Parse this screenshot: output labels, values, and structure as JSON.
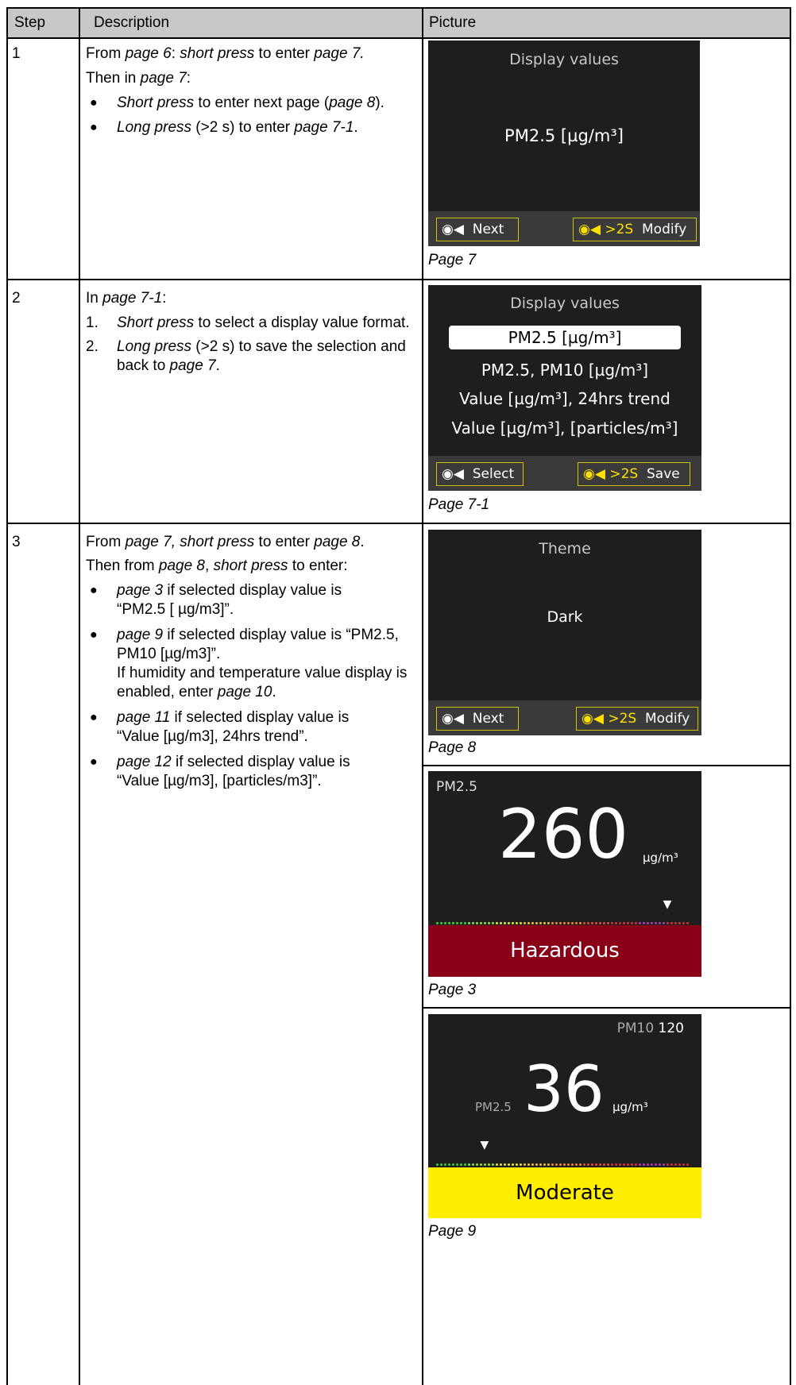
{
  "table": {
    "headers": {
      "step": "Step",
      "description": "Description",
      "picture": "Picture"
    },
    "row1": {
      "step": "1",
      "l1_a": "From ",
      "l1_b": "page 6",
      "l1_c": ": ",
      "l1_d": "short press",
      "l1_e": " to enter ",
      "l1_f": "page 7.",
      "l2_a": "Then in ",
      "l2_b": "page 7",
      "l2_c": ":",
      "b1_a": "Short press",
      "b1_b": " to enter next page (",
      "b1_c": "page 8",
      "b1_d": ").",
      "b2_a": "Long press",
      "b2_b": " (>2 s) to enter ",
      "b2_c": "page 7-1",
      "b2_d": ".",
      "caption": "Page 7"
    },
    "row2": {
      "step": "2",
      "l1_a": "In ",
      "l1_b": "page 7-1",
      "l1_c": ":",
      "n1": "1.",
      "n1_a": "Short press",
      "n1_b": " to select a display value format.",
      "n2": "2.",
      "n2_a": "Long press",
      "n2_b": " (>2 s) to save the selection and",
      "n2_c": "back to ",
      "n2_d": "page 7",
      "n2_e": ".",
      "caption": "Page 7-1"
    },
    "row3": {
      "step": "3",
      "l1_a": "From ",
      "l1_b": "page 7, short press",
      "l1_c": " to enter ",
      "l1_d": "page 8",
      "l1_e": ".",
      "l2_a": "Then from ",
      "l2_b": "page 8",
      "l2_c": ", ",
      "l2_d": "short press",
      "l2_e": " to enter:",
      "b1_a": "page 3",
      "b1_b": " if selected display value is",
      "b1_c": "“PM2.5 [ µg/m3]”.",
      "b2_a": "page 9",
      "b2_b": " if selected display value is “PM2.5,",
      "b2_c": "PM10 [µg/m3]”.",
      "b2_d": "If humidity and temperature value display is",
      "b2_e": "enabled, enter ",
      "b2_f": "page 10",
      "b2_g": ".",
      "b3_a": "page 11",
      "b3_b": " if selected display value is",
      "b3_c": "“Value [µg/m3], 24hrs trend”.",
      "b4_a": "page 12",
      "b4_b": " if selected display value is",
      "b4_c": "“Value [µg/m3], [particles/m3]”.",
      "caption8": "Page 8",
      "caption3": "Page 3",
      "caption9": "Page 9"
    }
  },
  "screens": {
    "p7": {
      "title": "Display values",
      "value": "PM2.5 [µg/m³]",
      "btn_left": "Next",
      "btn_right_long": ">2S",
      "btn_right": "Modify"
    },
    "p71": {
      "title": "Display values",
      "options": [
        "PM2.5 [µg/m³]",
        "PM2.5, PM10 [µg/m³]",
        "Value [µg/m³], 24hrs trend",
        "Value [µg/m³], [particles/m³]"
      ],
      "btn_left": "Select",
      "btn_right_long": ">2S",
      "btn_right": "Save"
    },
    "p8": {
      "title": "Theme",
      "value": "Dark",
      "btn_left": "Next",
      "btn_right_long": ">2S",
      "btn_right": "Modify"
    },
    "p3": {
      "label": "PM2.5",
      "value": "260",
      "unit": "µg/m³",
      "status": "Hazardous",
      "status_color": "#8a0016",
      "indicator_fraction": 0.9
    },
    "p9": {
      "secondary_label": "PM10",
      "secondary_value": "120",
      "label": "PM2.5",
      "value": "36",
      "unit": "µg/m³",
      "status": "Moderate",
      "status_color": "#ffee00",
      "indicator_fraction": 0.19
    }
  }
}
